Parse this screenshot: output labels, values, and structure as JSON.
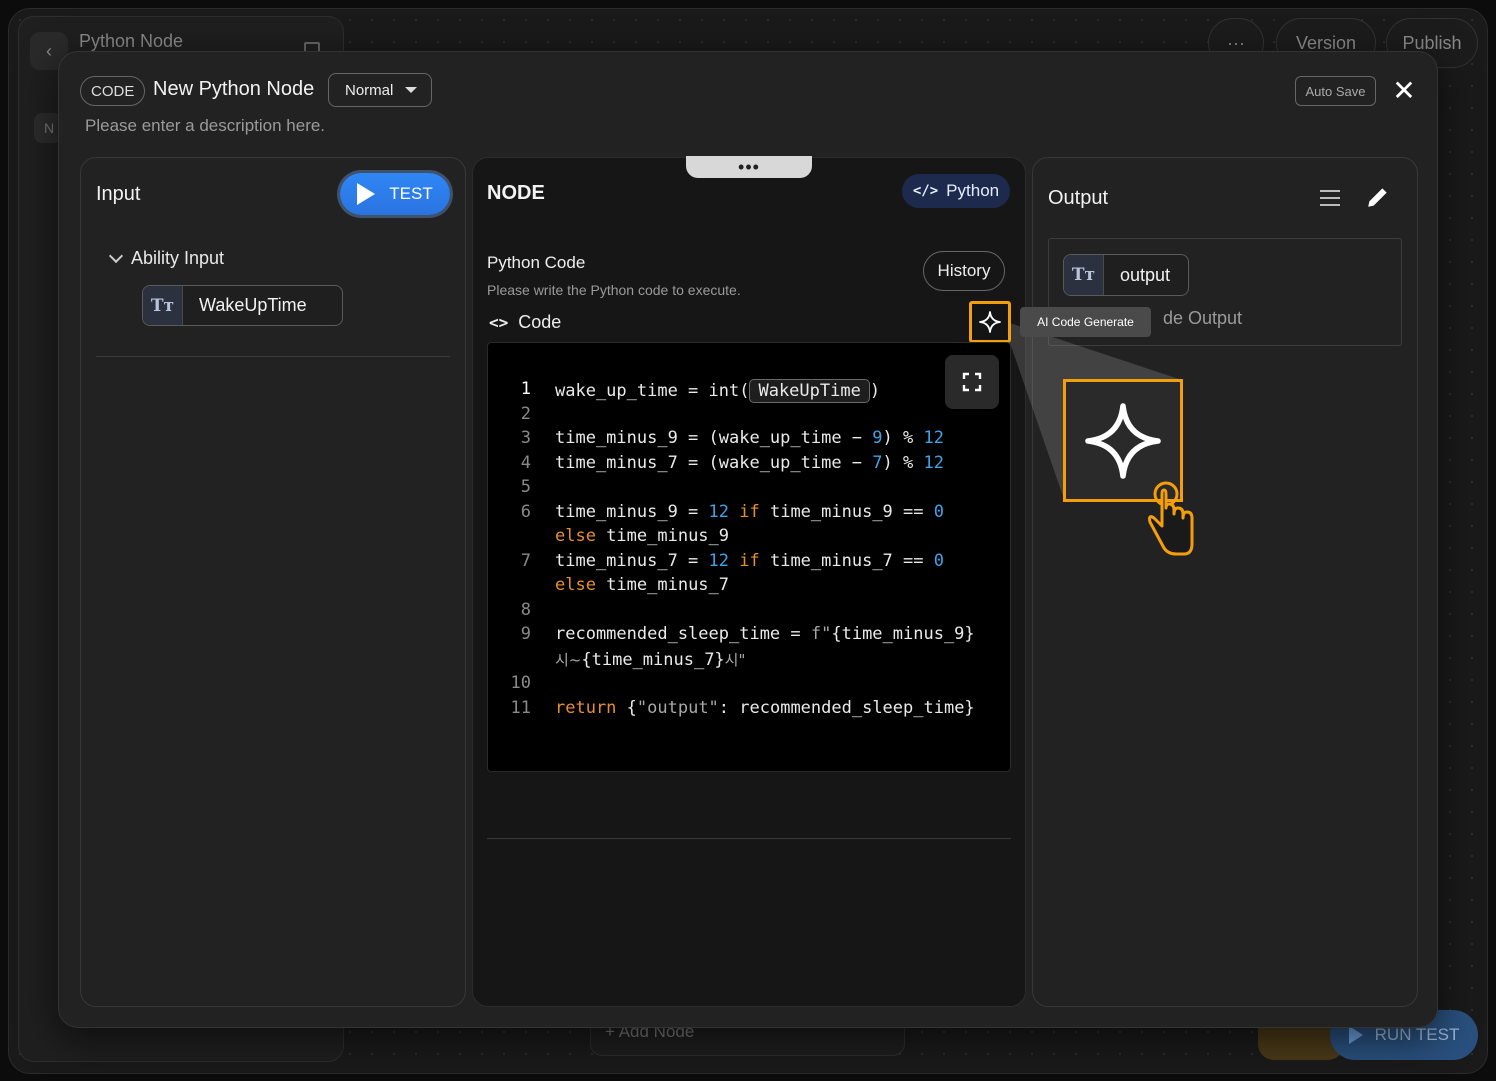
{
  "background": {
    "title": "Python Node",
    "back_glyph": "‹",
    "tab_abbrev": "N",
    "more_glyph": "···",
    "version_label": "Version",
    "publish_label": "Publish",
    "add_node_label": "+ Add Node",
    "run_test_label": "RUN TEST"
  },
  "modal": {
    "badge": "CODE",
    "title": "New Python Node",
    "mode": "Normal",
    "description": "Please enter a description here.",
    "autosave": "Auto Save",
    "close_glyph": "✕"
  },
  "input_panel": {
    "title": "Input",
    "test_label": "TEST",
    "group_label": "Ability Input",
    "variables": [
      {
        "type_icon": "Tт",
        "name": "WakeUpTime"
      }
    ]
  },
  "node_panel": {
    "handle": "•••",
    "title": "NODE",
    "language": "Python",
    "language_icon": "</>",
    "section_title": "Python Code",
    "section_desc": "Please write the Python code to execute.",
    "history_label": "History",
    "code_label": "Code",
    "code_icon": "<>",
    "ai_tooltip": "AI Code Generate",
    "line_numbers": [
      "1",
      "2",
      "3",
      "4",
      "5",
      "6",
      "",
      "7",
      "",
      "8",
      "9",
      "",
      "10",
      "11"
    ],
    "code": {
      "l1_pre": "wake_up_time = int(",
      "l1_var": "WakeUpTime",
      "l1_post": ")",
      "l3_a": "time_minus_9 = (wake_up_time − ",
      "l3_n1": "9",
      "l3_b": ") % ",
      "l3_n2": "12",
      "l4_a": "time_minus_7 = (wake_up_time − ",
      "l4_n1": "7",
      "l4_b": ") % ",
      "l4_n2": "12",
      "l6_a": "time_minus_9 = ",
      "l6_n1": "12",
      "l6_kw": " if ",
      "l6_b": "time_minus_9 == ",
      "l6_n2": "0",
      "l6c_kw": "else",
      "l6c_b": " time_minus_9",
      "l7_a": "time_minus_7 = ",
      "l7_n1": "12",
      "l7_kw": " if ",
      "l7_b": "time_minus_7 == ",
      "l7_n2": "0",
      "l7c_kw": "else",
      "l7c_b": " time_minus_7",
      "l9_a": "recommended_sleep_time = ",
      "l9_s": "f\"",
      "l9_b": "{time_minus_9}",
      "l9c_k1": "시~",
      "l9c_b": "{time_minus_7}",
      "l9c_k2": "시\"",
      "l11_kw": "return",
      "l11_a": " {",
      "l11_s": "\"output\"",
      "l11_b": ": recommended_sleep_time}"
    }
  },
  "output_panel": {
    "title": "Output",
    "variables": [
      {
        "type_icon": "Tт",
        "name": "output"
      }
    ],
    "hint": "de Output"
  },
  "colors": {
    "accent_blue": "#2f86f5",
    "highlight_orange": "#f59e0b",
    "keyword": "#e88f2d",
    "number": "#3ea3e6"
  }
}
